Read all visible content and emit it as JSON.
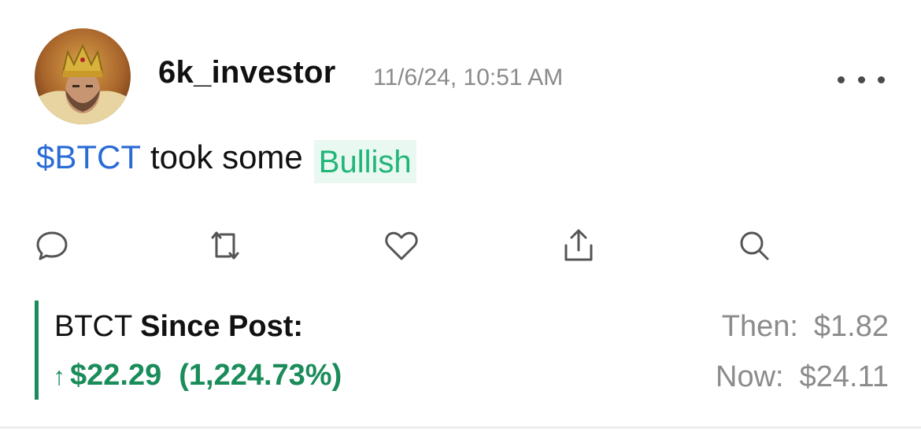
{
  "post": {
    "username": "6k_investor",
    "timestamp": "11/6/24, 10:51 AM",
    "cashtag": "$BTCT",
    "body": "took some",
    "sentiment": "Bullish"
  },
  "icons": [
    "avatar-image",
    "more-icon",
    "comment-icon",
    "repost-icon",
    "like-icon",
    "share-icon",
    "search-icon"
  ],
  "performance": {
    "ticker": "BTCT",
    "since_label": "Since Post:",
    "arrow": "↑",
    "change": "$22.29",
    "change_pct": "(1,224.73%)",
    "then_label": "Then:",
    "then_value": "$1.82",
    "now_label": "Now:",
    "now_value": "$24.11"
  },
  "colors": {
    "cashtag": "#2a6bd6",
    "bullish_text": "#21b578",
    "bullish_bg": "#e9f8f0",
    "gain": "#1a8c5a",
    "muted": "#8b8b8b"
  }
}
